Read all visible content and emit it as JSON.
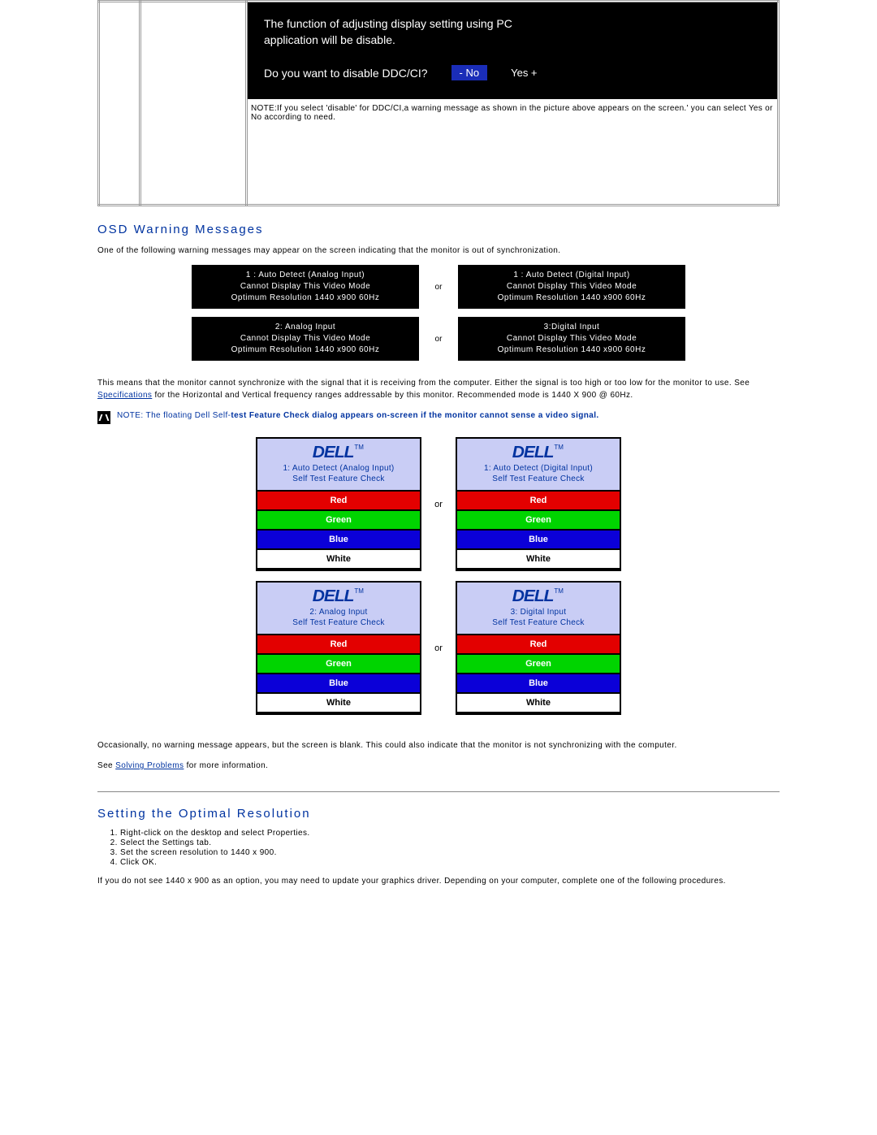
{
  "ddc_dialog": {
    "line1": "The function of adjusting display setting   using PC",
    "line2": "application   will be disable.",
    "question": "Do you want to disable DDC/CI?",
    "no_label": "-  No",
    "yes_label": "Yes  +"
  },
  "top_note": "NOTE:If you select 'disable' for DDC/CI,a warning message as shown in the picture above appears on the screen.' you can select Yes or No according to need.",
  "heading_osd": "OSD Warning Messages",
  "intro_osd": "One of the following warning messages may appear on the screen indicating that the monitor is out of synchronization.",
  "warn_boxes": {
    "r1c1": {
      "l1": "1 : Auto Detect (Analog Input)",
      "l2": "Cannot Display This Video Mode",
      "l3": "Optimum Resolution 1440 x900 60Hz"
    },
    "r1c2": {
      "l1": "1 : Auto Detect (Digital Input)",
      "l2": "Cannot Display This Video Mode",
      "l3": "Optimum Resolution 1440 x900 60Hz"
    },
    "r2c1": {
      "l1": "2: Analog Input",
      "l2": "Cannot Display This Video Mode",
      "l3": "Optimum Resolution 1440 x900 60Hz"
    },
    "r2c2": {
      "l1": "3:Digital Input",
      "l2": "Cannot Display This Video Mode",
      "l3": "Optimum Resolution 1440 x900 60Hz"
    },
    "or": "or"
  },
  "sync_para": {
    "pre": "This means that the monitor cannot synchronize with the signal that it is receiving from the computer. Either the signal is too high or too low for the monitor to use.  See ",
    "link": "Specifications",
    "post": " for the Horizontal and Vertical frequency ranges addressable by this monitor. Recommended mode is 1440 X 900 @ 60Hz."
  },
  "note_selftest": {
    "pre": "NOTE: The floating Dell Self-",
    "bold": "test Feature Check dialog appears on-screen if the monitor cannot sense a video signal."
  },
  "selftest": {
    "box1": {
      "sub1": "1: Auto Detect (Analog Input)",
      "sub2": "Self Test  Feature Check"
    },
    "box2": {
      "sub1": "1: Auto Detect (Digital Input)",
      "sub2": "Self Test  Feature Check"
    },
    "box3": {
      "sub1": "2: Analog Input",
      "sub2": "Self Test  Feature Check"
    },
    "box4": {
      "sub1": "3: Digital Input",
      "sub2": "Self Test  Feature Check"
    },
    "or": "or",
    "red": "Red",
    "green": "Green",
    "blue": "Blue",
    "white": "White",
    "logo": "DELL",
    "tm": "TM"
  },
  "blank_para": "Occasionally, no warning message appears, but the screen is blank. This could also indicate that the monitor is not synchronizing with the computer.",
  "see_problems": {
    "pre": "See ",
    "link": "Solving Problems",
    "post": " for more information."
  },
  "heading_res": "Setting the Optimal Resolution",
  "steps": {
    "s1": "Right-click on the desktop and select Properties.",
    "s2": "Select the Settings tab.",
    "s3": "Set the screen resolution to 1440 x 900.",
    "s4": "Click OK."
  },
  "res_para": "If you do not see 1440 x 900 as an option, you may need to update your graphics driver. Depending on your computer, complete one of the following procedures."
}
